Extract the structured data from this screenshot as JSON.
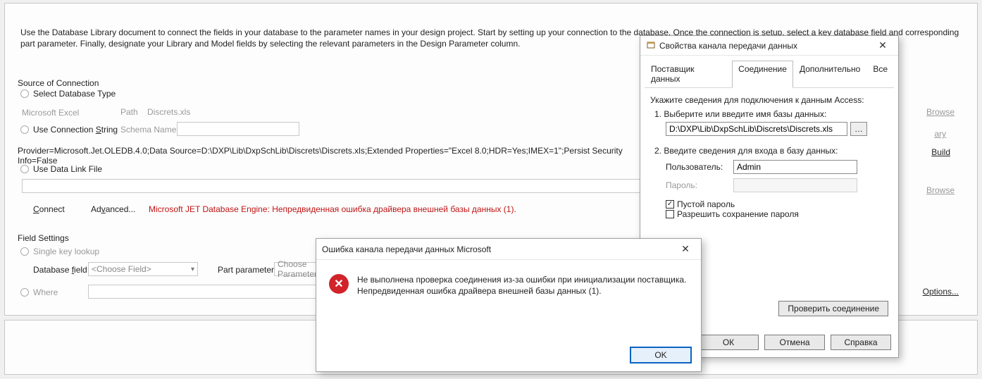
{
  "instruction": "Use the Database Library document to connect the fields in your database to the parameter names in your design project. Start by setting up your connection to the database. Once the connection is setup, select a key database field and corresponding part parameter. Finally, designate your Library and Model fields by selecting the relevant parameters in the Design Parameter column.",
  "labels": {
    "source_of_connection": "Source of Connection",
    "select_db_type": "Select Database Type",
    "ms_excel": "Microsoft Excel",
    "path_label": "Path",
    "path_value": "Discrets.xls",
    "use_conn_string": "Use Connection ",
    "use_conn_string_u": "S",
    "use_conn_string_tail": "tring",
    "schema_name": "Schema Name",
    "conn_string": "Provider=Microsoft.Jet.OLEDB.4.0;Data Source=D:\\DXP\\Lib\\DxpSchLib\\Discrets\\Discrets.xls;Extended Properties=\"Excel 8.0;HDR=Yes;IMEX=1\";Persist Security Info=False",
    "use_data_link": "Use Data Link File",
    "connect": "onnect",
    "connect_u": "C",
    "advanced": "Ad",
    "advanced_u": "v",
    "advanced_tail": "anced...",
    "jet_error": "Microsoft JET Database Engine: Непредвиденная ошибка драйвера внешней базы данных (1).",
    "field_settings": "Field Settings",
    "single_key": "Single key lookup",
    "database_field": "Database ",
    "database_field_u": "f",
    "database_field_tail": "ield",
    "choose_field": "<Choose Field>",
    "part_parameter": "Part parameter",
    "choose_parameter": "Choose Parameter",
    "where": "Where",
    "browse1": "B",
    "browse1_u": "r",
    "browse1_tail": "owse",
    "build_u1": "B",
    "build_u": "u",
    "build_tail": "ild",
    "browse2_u1": "Bro",
    "browse2_u": "w",
    "browse2_tail": "se",
    "options_u1": "O",
    "options_u": "p",
    "options_tail": "tions..."
  },
  "error_dialog": {
    "title": "Ошибка канала передачи данных Microsoft",
    "message": "Не выполнена проверка соединения из-за ошибки при инициализации поставщика. Непредвиденная ошибка драйвера внешней базы данных (1).",
    "ok": "OK"
  },
  "props_dialog": {
    "title": "Свойства канала передачи данных",
    "tabs": {
      "t1": "Поставщик данных",
      "t2": "Соединение",
      "t3": "Дополнительно",
      "t4": "Все"
    },
    "intro": "Укажите сведения для подключения к данным Access:",
    "step1": "1. Выберите или введите имя базы данных:",
    "db_path": "D:\\DXP\\Lib\\DxpSchLib\\Discrets\\Discrets.xls",
    "step2": "2. Введите сведения для входа в базу данных:",
    "user_label": "Пользователь:",
    "user_value": "Admin",
    "pass_label": "Пароль:",
    "chk_empty": "Пустой пароль",
    "chk_save": "Разрешить сохранение пароля",
    "test": "Проверить соединение",
    "ok": "ОК",
    "cancel": "Отмена",
    "help": "Справка"
  }
}
